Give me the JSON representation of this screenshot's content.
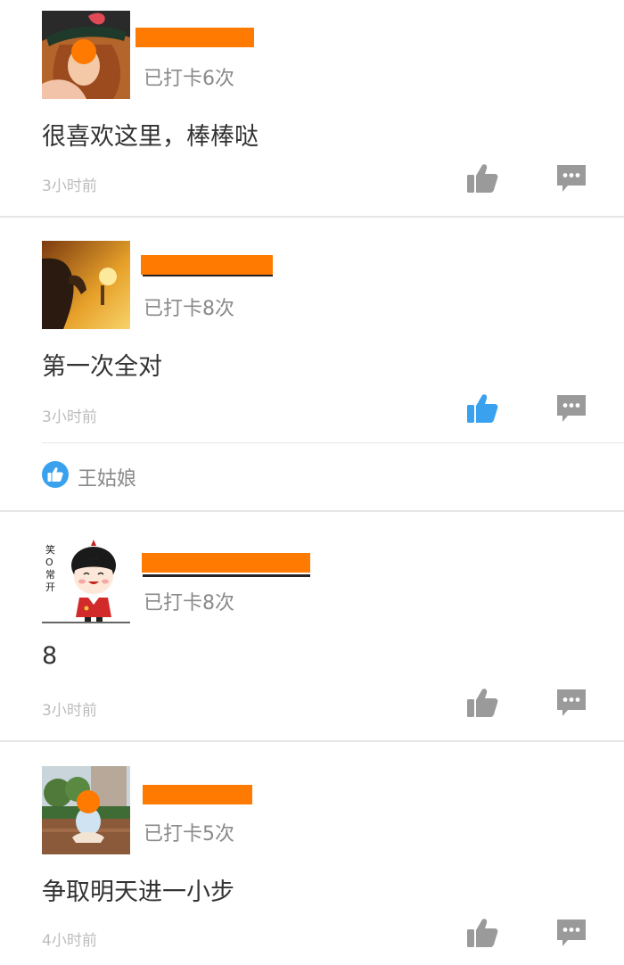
{
  "posts": [
    {
      "checkin": "已打卡6次",
      "content": "很喜欢这里，棒棒哒",
      "time": "3小时前",
      "liked": false,
      "avatar": "avatar-girl-hat"
    },
    {
      "checkin": "已打卡8次",
      "content": "第一次全对",
      "time": "3小时前",
      "liked": true,
      "avatar": "avatar-sunset-silhouette",
      "likes": [
        "王姑娘"
      ]
    },
    {
      "checkin": "已打卡8次",
      "content": "8",
      "time": "3小时前",
      "liked": false,
      "avatar": "avatar-cartoon-kid",
      "avatar_caption": "笑O常开"
    },
    {
      "checkin": "已打卡5次",
      "content": "争取明天进一小步",
      "time": "4小时前",
      "liked": false,
      "avatar": "avatar-child-field"
    }
  ],
  "colors": {
    "redaction": "#ff7a00",
    "like_active": "#3aa1ef",
    "icon_inactive": "#9a9a9a",
    "time_text": "#bcbcbc",
    "meta_text": "#8a8a8a"
  },
  "icons": {
    "like": "thumbs-up-icon",
    "comment": "comment-bubble-icon"
  }
}
